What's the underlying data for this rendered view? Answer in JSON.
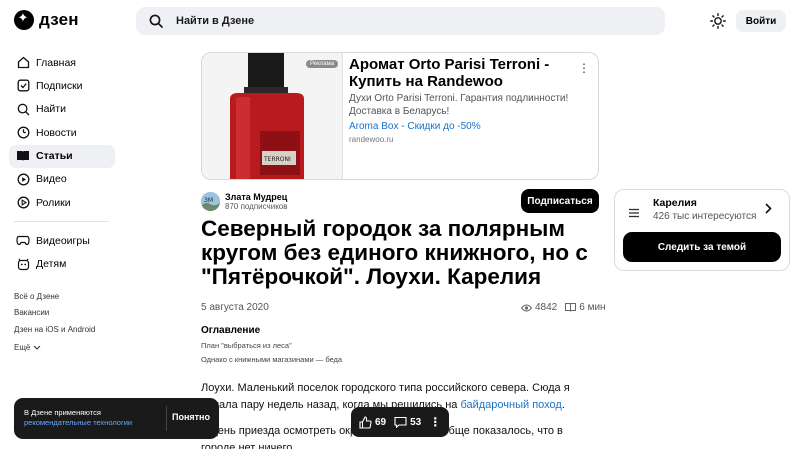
{
  "header": {
    "logo_text": "дзен",
    "search_placeholder": "Найти в Дзене",
    "login_label": "Войти"
  },
  "sidebar": {
    "items": [
      {
        "label": "Главная",
        "icon": "home-icon"
      },
      {
        "label": "Подписки",
        "icon": "subscriptions-icon"
      },
      {
        "label": "Найти",
        "icon": "search-icon"
      },
      {
        "label": "Новости",
        "icon": "news-icon"
      },
      {
        "label": "Статьи",
        "icon": "articles-icon",
        "active": true
      },
      {
        "label": "Видео",
        "icon": "video-icon"
      },
      {
        "label": "Ролики",
        "icon": "shorts-icon"
      }
    ],
    "items2": [
      {
        "label": "Видеоигры",
        "icon": "gamepad-icon"
      },
      {
        "label": "Детям",
        "icon": "kids-icon"
      }
    ],
    "links": [
      "Всё о Дзене",
      "Вакансии",
      "Дзен на iOS и Android",
      "Ещё"
    ]
  },
  "ad": {
    "badge": "Реклама",
    "title": "Аромат Orto Parisi Terroni - Купить на Randewoo",
    "description": "Духи Orto Parisi Terroni. Гарантия подлинности! Доставка в Беларусь!",
    "promo": "Aroma Box - Скидки до -50%",
    "url": "randewoo.ru",
    "bottle_label": "TERRONI"
  },
  "author": {
    "name": "Злата Мудрец",
    "subscribers": "870 подписчиков",
    "avatar_text": "ЗМ",
    "subscribe_label": "Подписаться"
  },
  "article": {
    "title": "Северный городок за полярным кругом без единого книжного, но с \"Пятёрочкой\". Лоухи. Карелия",
    "date": "5 августа 2020",
    "views": "4842",
    "read_time": "6 мин",
    "toc_title": "Оглавление",
    "toc": [
      "План \"выбраться из леса\"",
      "Однако с книжными магазинами — беда"
    ],
    "body_p1_before": "Лоухи. Маленький поселок городского типа российского севера. Сюда я попала пару недель назад, когда мы решились на ",
    "body_p1_link": "байдарочный поход",
    "body_p1_after": ".",
    "body_p2": "В день приезда осмотреть окрестности, мне вообще показалось, что в городе нет ничего."
  },
  "topic": {
    "name": "Карелия",
    "count": "426 тыс интересуются",
    "follow_label": "Следить за темой"
  },
  "cookie": {
    "text": "В Дзене применяются",
    "link": "рекомендательные технологии",
    "button": "Понятно"
  },
  "reactions": {
    "likes": "69",
    "comments": "53"
  },
  "colors": {
    "accent_link": "#1a73c9",
    "dark_button": "#000000",
    "surface": "#eef0f3"
  }
}
